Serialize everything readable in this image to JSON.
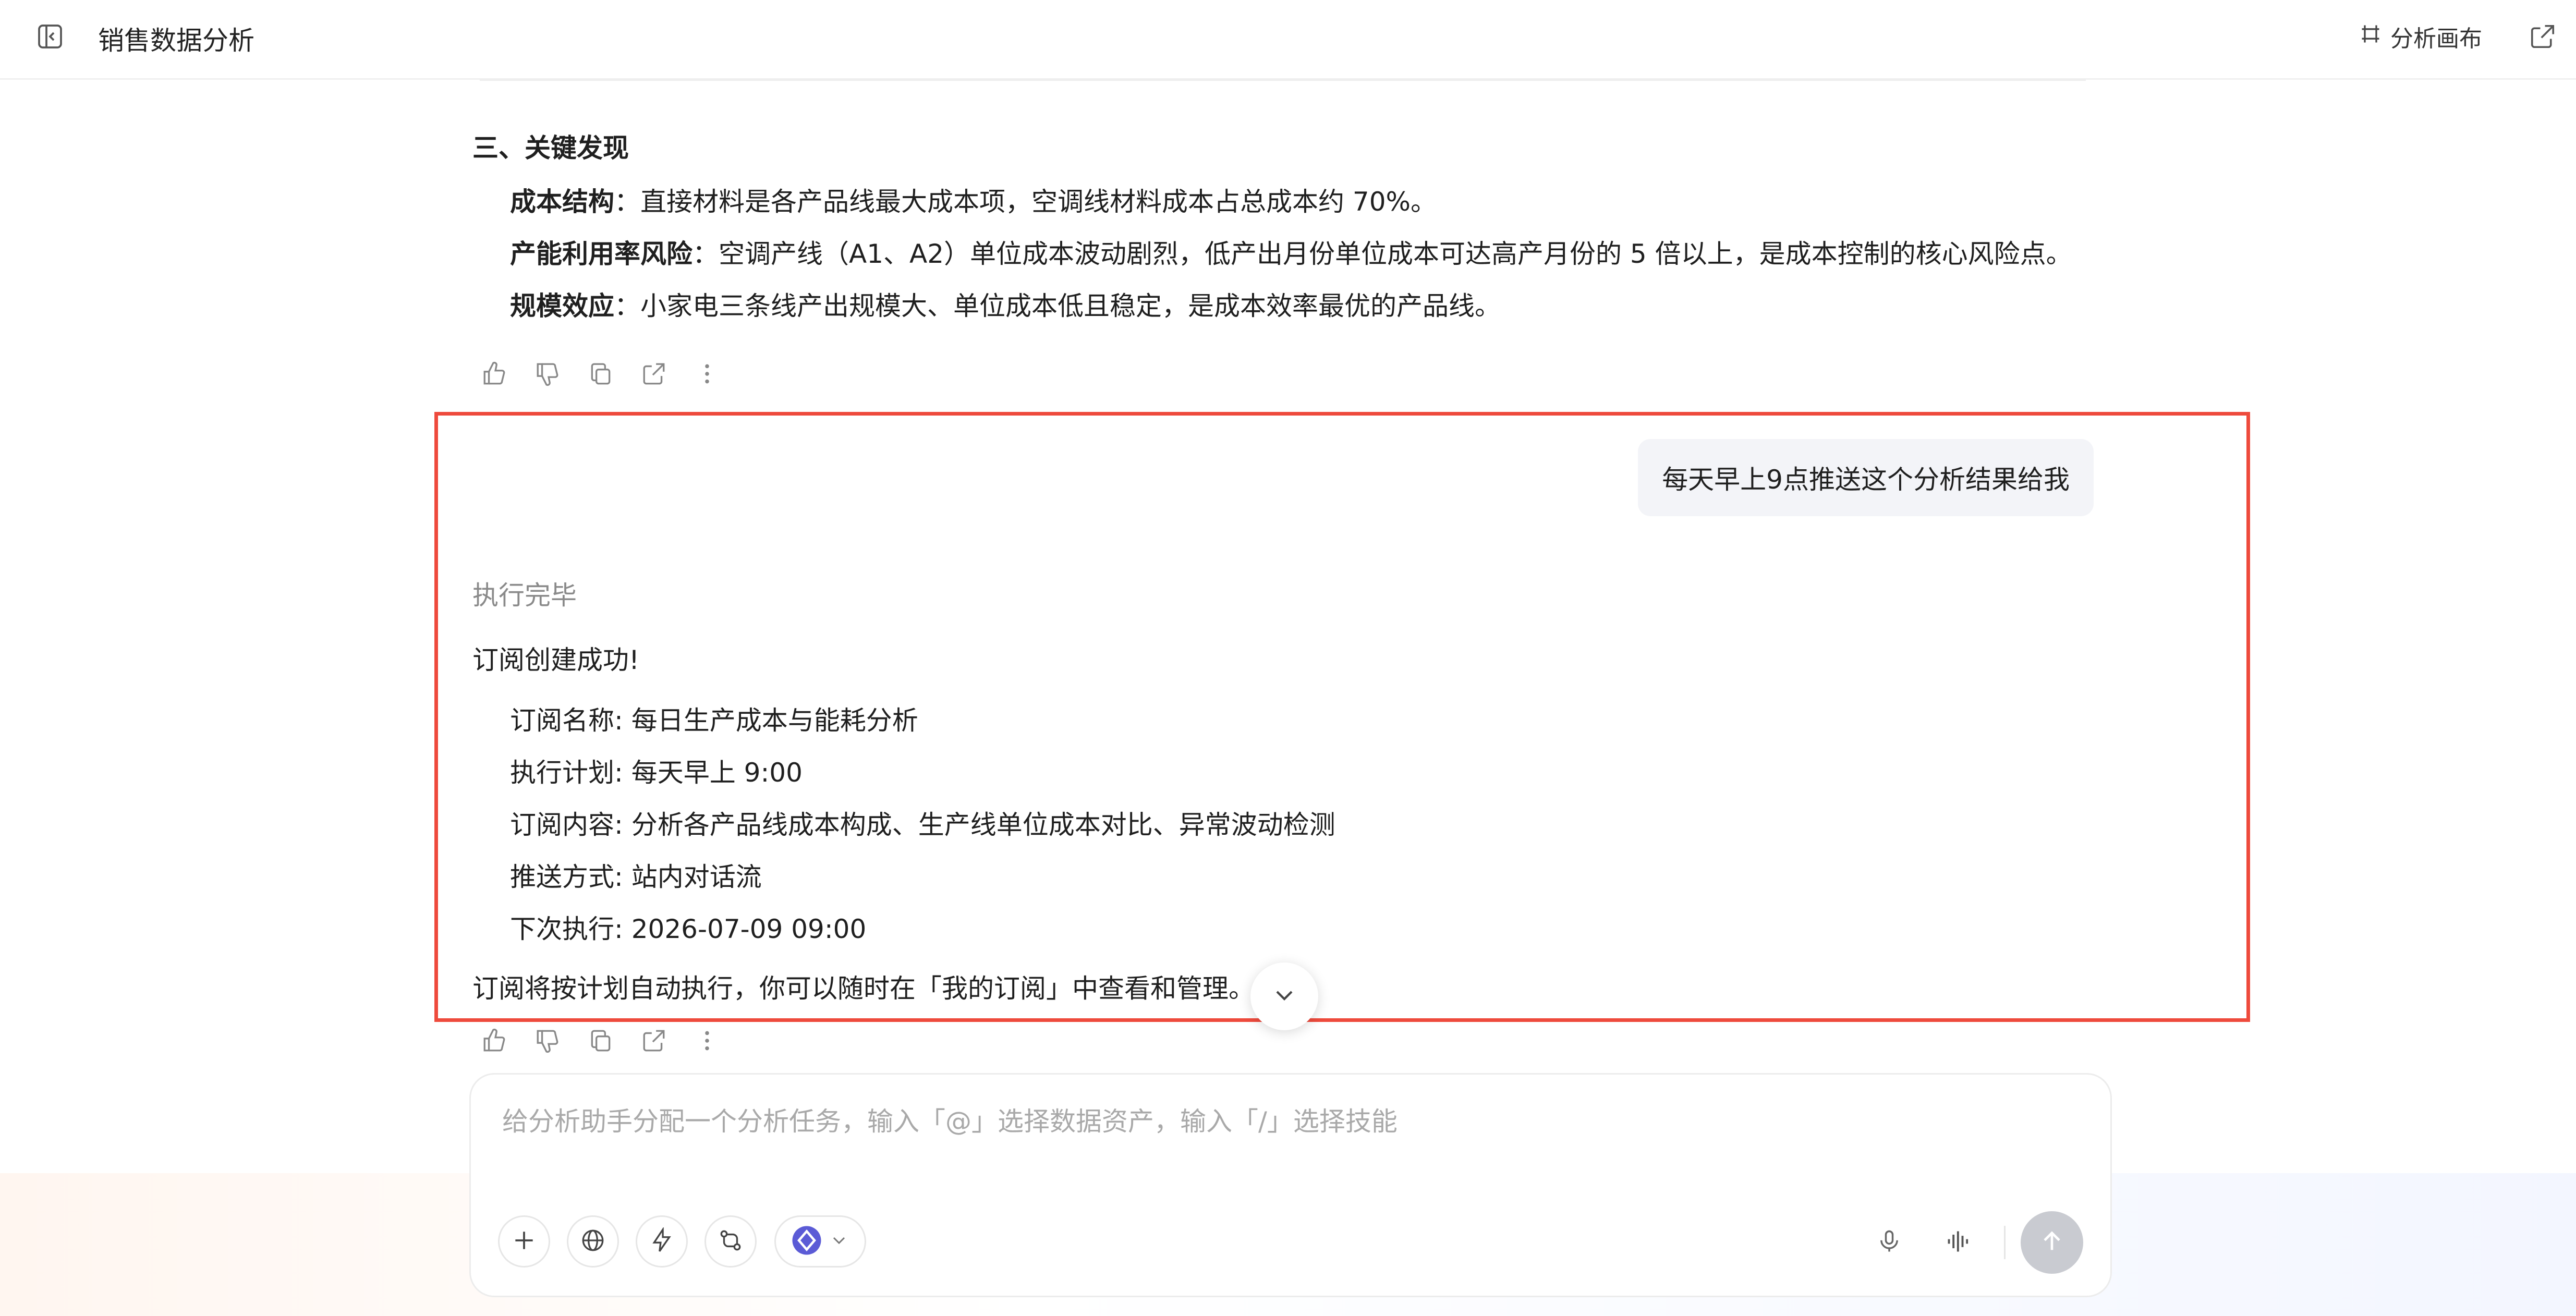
{
  "header": {
    "title": "销售数据分析",
    "canvas_label": "分析画布"
  },
  "findings": {
    "title": "三、关键发现",
    "items": [
      {
        "label": "成本结构",
        "text": "：直接材料是各产品线最大成本项，空调线材料成本占总成本约 70%。"
      },
      {
        "label": "产能利用率风险",
        "text": "：空调产线（A1、A2）单位成本波动剧烈，低产出月份单位成本可达高产月份的 5 倍以上，是成本控制的核心风险点。"
      },
      {
        "label": "规模效应",
        "text": "：小家电三条线产出规模大、单位成本低且稳定，是成本效率最优的产品线。"
      }
    ]
  },
  "user_message": "每天早上9点推送这个分析结果给我",
  "reply": {
    "status": "执行完毕",
    "headline": "订阅创建成功!",
    "details": [
      "订阅名称: 每日生产成本与能耗分析",
      "执行计划: 每天早上 9:00",
      "订阅内容: 分析各产品线成本构成、生产线单位成本对比、异常波动检测",
      "推送方式: 站内对话流",
      "下次执行: 2026-07-09 09:00"
    ],
    "footer": "订阅将按计划自动执行，你可以随时在「我的订阅」中查看和管理。"
  },
  "input": {
    "placeholder": "给分析助手分配一个分析任务，输入「@」选择数据资产，输入「/」选择技能"
  },
  "colors": {
    "highlight": "#ee4a3c",
    "model_accent": "#5b5bd6",
    "send_disabled": "#c9cbd1"
  }
}
